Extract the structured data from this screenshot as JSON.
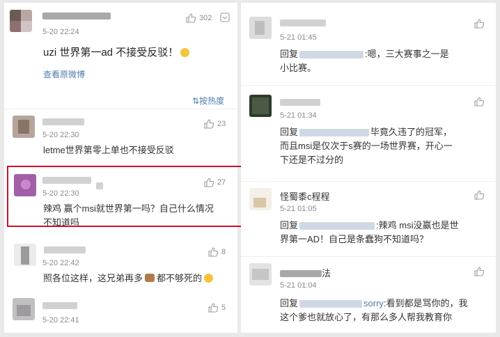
{
  "left": {
    "top_post": {
      "time": "5-20 22:24",
      "like_count": "302",
      "text": "uzi 世界第一ad 不接受反驳！",
      "link": "查看原微博"
    },
    "sort_label": "按热度",
    "comments": [
      {
        "time": "5-20 22:30",
        "like_count": "23",
        "text": "letme世界第零上单也不接受反驳"
      },
      {
        "time": "5-20 22:30",
        "like_count": "27",
        "text_line1": "辣鸡  赢个msi就世界第一吗？自己什么情况",
        "text_line2": "不知道吗"
      },
      {
        "time": "5-20 22:42",
        "like_count": "8",
        "text": "照各位这样，这兄弟再多",
        "text_tail": "都不够死的"
      },
      {
        "time": "5-20 22:41",
        "like_count": "5"
      }
    ]
  },
  "right": {
    "comments": [
      {
        "time": "5-21 01:45",
        "reply_prefix": "回复",
        "line1_tail": ":嗯，三大赛事之一是",
        "line2": "小比赛。"
      },
      {
        "time": "5-21 01:34",
        "reply_prefix": "回复",
        "line1_tail": "毕竟久违了的冠军，",
        "line2": "而且msi是仅次于s赛的一场世界赛，开心一",
        "line3": "下还是不过分的"
      },
      {
        "name": "怪蜀黍c程程",
        "time": "5-21 01:05",
        "reply_prefix": "回复",
        "line1_tail": ":辣鸡 msi没赢也是世",
        "line2": "界第一AD！自己是条蠢狗不知道吗？"
      },
      {
        "name_tail": "法",
        "time": "5-21 01:04",
        "reply_prefix": "回复",
        "mention_tail": "sorry",
        "line1_tail": ":看到都是骂你的，我",
        "line2": "这个爹也就放心了，有那么多人帮我教育你"
      }
    ]
  }
}
